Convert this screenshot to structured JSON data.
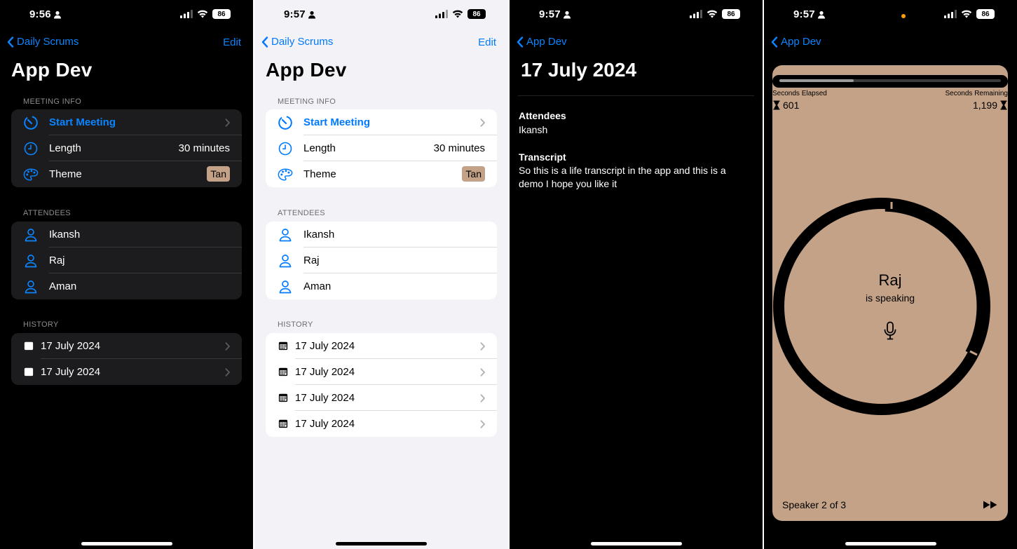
{
  "screens": [
    {
      "time": "9:56",
      "battery": "86",
      "back_label": "Daily Scrums",
      "edit_label": "Edit",
      "title": "App Dev",
      "meeting_info_header": "MEETING INFO",
      "start_meeting": "Start Meeting",
      "length_label": "Length",
      "length_value": "30 minutes",
      "theme_label": "Theme",
      "theme_value": "Tan",
      "attendees_header": "ATTENDEES",
      "attendees": [
        "Ikansh",
        "Raj",
        "Aman"
      ],
      "history_header": "HISTORY",
      "history": [
        "17 July 2024",
        "17 July 2024"
      ]
    },
    {
      "time": "9:57",
      "battery": "86",
      "back_label": "Daily Scrums",
      "edit_label": "Edit",
      "title": "App Dev",
      "meeting_info_header": "MEETING INFO",
      "start_meeting": "Start Meeting",
      "length_label": "Length",
      "length_value": "30 minutes",
      "theme_label": "Theme",
      "theme_value": "Tan",
      "attendees_header": "ATTENDEES",
      "attendees": [
        "Ikansh",
        "Raj",
        "Aman"
      ],
      "history_header": "HISTORY",
      "history": [
        "17 July 2024",
        "17 July 2024",
        "17 July 2024",
        "17 July 2024"
      ]
    },
    {
      "time": "9:57",
      "battery": "86",
      "back_label": "App Dev",
      "title": "17 July 2024",
      "attendees_label": "Attendees",
      "attendees_value": "Ikansh",
      "transcript_label": "Transcript",
      "transcript_line1": "So this is a life transcript in the app and this is a",
      "transcript_line2": "demo I hope you like it"
    },
    {
      "time": "9:57",
      "battery": "86",
      "back_label": "App Dev",
      "seconds_elapsed_label": "Seconds Elapsed",
      "seconds_elapsed": "601",
      "seconds_remaining_label": "Seconds Remaining",
      "seconds_remaining": "1,199",
      "progress_fraction": 0.334,
      "speaker_name": "Raj",
      "speaking_label": "is speaking",
      "speaker_count": "Speaker 2 of 3"
    }
  ],
  "colors": {
    "accent_dark": "#0a84ff",
    "accent_light": "#007aff",
    "theme_tan": "#c4a287"
  },
  "icons": [
    "person-icon",
    "signal-icon",
    "wifi-icon",
    "chevron-left-icon",
    "timer-icon",
    "clock-icon",
    "palette-icon",
    "chevron-right-icon",
    "calendar-icon",
    "hourglass-icon",
    "mic-icon",
    "forward-icon"
  ]
}
